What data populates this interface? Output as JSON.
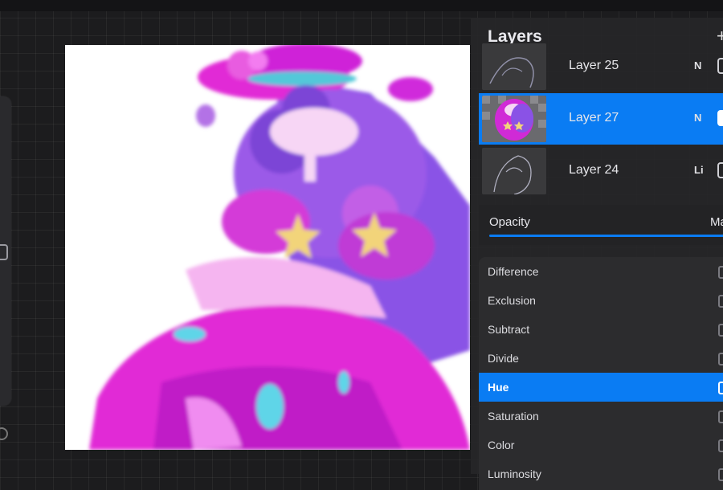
{
  "panel": {
    "title": "Layers",
    "add_label": "+"
  },
  "layers": [
    {
      "name": "Layer 25",
      "mode": "N"
    },
    {
      "name": "Layer 27",
      "mode": "N",
      "active": true
    },
    {
      "name": "Layer 24",
      "mode": "Li"
    }
  ],
  "opacity": {
    "label": "Opacity",
    "value_text": "Ma"
  },
  "blend_modes": [
    "Difference",
    "Exclusion",
    "Subtract",
    "Divide",
    "Hue",
    "Saturation",
    "Color",
    "Luminosity"
  ],
  "active_blend": "Hue",
  "colors": {
    "accent": "#0a7cf3",
    "panel_bg": "#262628",
    "canvas_bg": "#ffffff",
    "magenta": "#e12ad6",
    "purple": "#8a52e6"
  },
  "icons": {
    "add": "plus-icon",
    "visibility": "checkbox-icon",
    "blend": "blend-mode-icon"
  }
}
